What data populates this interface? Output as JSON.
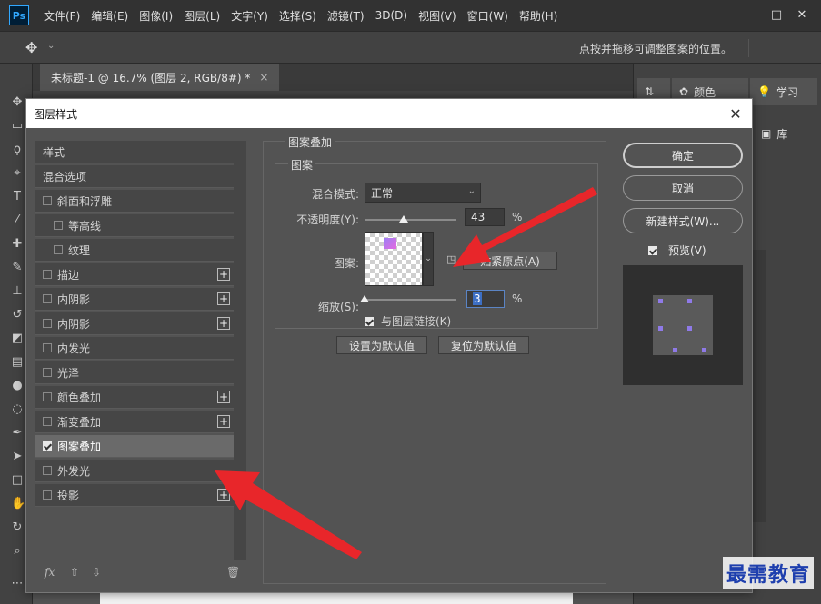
{
  "app": {
    "logo_text": "Ps",
    "menu": [
      "文件(F)",
      "编辑(E)",
      "图像(I)",
      "图层(L)",
      "文字(Y)",
      "选择(S)",
      "滤镜(T)",
      "3D(D)",
      "视图(V)",
      "窗口(W)",
      "帮助(H)"
    ],
    "window_controls": [
      "–",
      "□",
      "✕"
    ]
  },
  "options_bar": {
    "hint": "点按并拖移可调整图案的位置。"
  },
  "document_tab": {
    "title": "未标题-1 @ 16.7% (图层 2, RGB/8#) *",
    "close": "×"
  },
  "right_panels": {
    "color_label": "颜色",
    "learn_label": "学习",
    "library_label": "库"
  },
  "dialog": {
    "title": "图层样式",
    "close": "✕",
    "style_list": [
      {
        "label": "样式",
        "checkbox": false,
        "plus": false,
        "indent": 0,
        "active": false,
        "checked": false
      },
      {
        "label": "混合选项",
        "checkbox": false,
        "plus": false,
        "indent": 0,
        "active": false,
        "checked": false
      },
      {
        "label": "斜面和浮雕",
        "checkbox": true,
        "plus": false,
        "indent": 0,
        "active": false,
        "checked": false
      },
      {
        "label": "等高线",
        "checkbox": true,
        "plus": false,
        "indent": 1,
        "active": false,
        "checked": false
      },
      {
        "label": "纹理",
        "checkbox": true,
        "plus": false,
        "indent": 1,
        "active": false,
        "checked": false
      },
      {
        "label": "描边",
        "checkbox": true,
        "plus": true,
        "indent": 0,
        "active": false,
        "checked": false
      },
      {
        "label": "内阴影",
        "checkbox": true,
        "plus": true,
        "indent": 0,
        "active": false,
        "checked": false
      },
      {
        "label": "内阴影",
        "checkbox": true,
        "plus": true,
        "indent": 0,
        "active": false,
        "checked": false
      },
      {
        "label": "内发光",
        "checkbox": true,
        "plus": false,
        "indent": 0,
        "active": false,
        "checked": false
      },
      {
        "label": "光泽",
        "checkbox": true,
        "plus": false,
        "indent": 0,
        "active": false,
        "checked": false
      },
      {
        "label": "颜色叠加",
        "checkbox": true,
        "plus": true,
        "indent": 0,
        "active": false,
        "checked": false
      },
      {
        "label": "渐变叠加",
        "checkbox": true,
        "plus": true,
        "indent": 0,
        "active": false,
        "checked": false
      },
      {
        "label": "图案叠加",
        "checkbox": true,
        "plus": false,
        "indent": 0,
        "active": true,
        "checked": true
      },
      {
        "label": "外发光",
        "checkbox": true,
        "plus": false,
        "indent": 0,
        "active": false,
        "checked": false
      },
      {
        "label": "投影",
        "checkbox": true,
        "plus": true,
        "indent": 0,
        "active": false,
        "checked": false
      }
    ],
    "footer": {
      "fx": "fx",
      "up": "⇧",
      "down": "⇩",
      "trash": "🗑"
    },
    "pattern_overlay": {
      "group_title": "图案叠加",
      "subgroup_title": "图案",
      "blend_mode_label": "混合模式:",
      "blend_mode_value": "正常",
      "opacity_label": "不透明度(Y):",
      "opacity_value": "43",
      "opacity_level": 0.43,
      "percent": "%",
      "pattern_label": "图案:",
      "snap_origin_label": "贴紧原点(A)",
      "scale_label": "缩放(S):",
      "scale_value": "3",
      "scale_level": 0.0,
      "link_label": "与图层链接(K)",
      "link_checked": true,
      "set_default_label": "设置为默认值",
      "reset_default_label": "复位为默认值"
    },
    "buttons": {
      "ok": "确定",
      "cancel": "取消",
      "new_style": "新建样式(W)...",
      "preview_label": "预览(V)",
      "preview_checked": true
    }
  },
  "watermark": "最需教育",
  "colors": {
    "accent_arrow": "#e8262a",
    "pattern_purple": "#8f7ae8"
  }
}
